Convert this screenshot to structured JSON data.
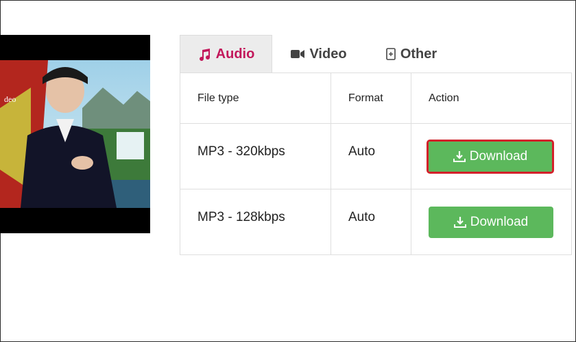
{
  "tabs": [
    {
      "label": "Audio",
      "icon": "music-icon",
      "active": true
    },
    {
      "label": "Video",
      "icon": "video-camera-icon",
      "active": false
    },
    {
      "label": "Other",
      "icon": "file-plus-icon",
      "active": false
    }
  ],
  "table": {
    "headers": [
      "File type",
      "Format",
      "Action"
    ],
    "rows": [
      {
        "file_type": "MP3 - 320kbps",
        "format": "Auto",
        "action": "Download",
        "highlighted": true
      },
      {
        "file_type": "MP3 - 128kbps",
        "format": "Auto",
        "action": "Download",
        "highlighted": false
      }
    ]
  },
  "thumbnail": {
    "caption_fragment": "deo"
  },
  "colors": {
    "active_tab_text": "#c2185b",
    "button_green": "#5cb85c",
    "highlight_red": "#d3202a"
  }
}
